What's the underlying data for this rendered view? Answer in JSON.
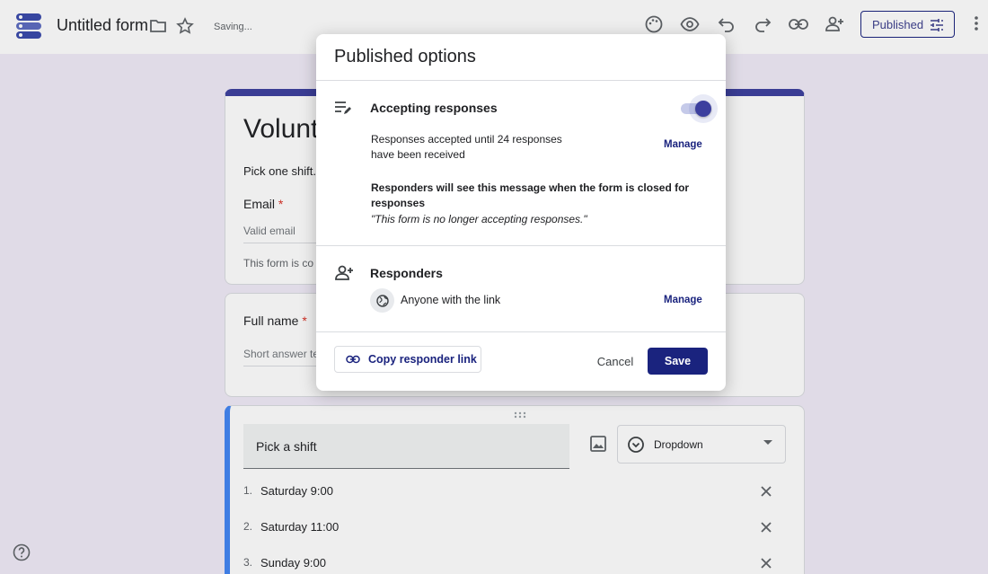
{
  "header": {
    "form_title": "Untitled form",
    "status": "Saving...",
    "publish_label": "Published"
  },
  "title_card": {
    "title": "Volunte",
    "description": "Pick one shift.",
    "email_label": "Email",
    "required_mark": "*",
    "email_placeholder": "Valid email",
    "notice": "This form is co"
  },
  "name_card": {
    "question": "Full name",
    "required_mark": "*",
    "placeholder": "Short answer te"
  },
  "shift_card": {
    "question": "Pick a shift",
    "type": "Dropdown",
    "options": [
      {
        "num": "1.",
        "label": "Saturday 9:00"
      },
      {
        "num": "2.",
        "label": "Saturday 11:00"
      },
      {
        "num": "3.",
        "label": "Sunday 9:00"
      }
    ]
  },
  "dialog": {
    "title": "Published options",
    "accepting": {
      "heading": "Accepting responses",
      "toggle_on": true,
      "limit_text": "Responses accepted until 24 responses have been received",
      "manage_label": "Manage",
      "closed_msg_bold": "Responders will see this message when the form is closed for responses",
      "closed_msg_quote": "\"This form is no longer accepting responses.\""
    },
    "responders": {
      "heading": "Responders",
      "access": "Anyone with the link",
      "manage_label": "Manage"
    },
    "copy_link_label": "Copy responder link",
    "cancel_label": "Cancel",
    "save_label": "Save"
  },
  "colors": {
    "accent": "#1a237e",
    "form_theme": "#3c3f9e",
    "background": "#f0ebf8"
  }
}
